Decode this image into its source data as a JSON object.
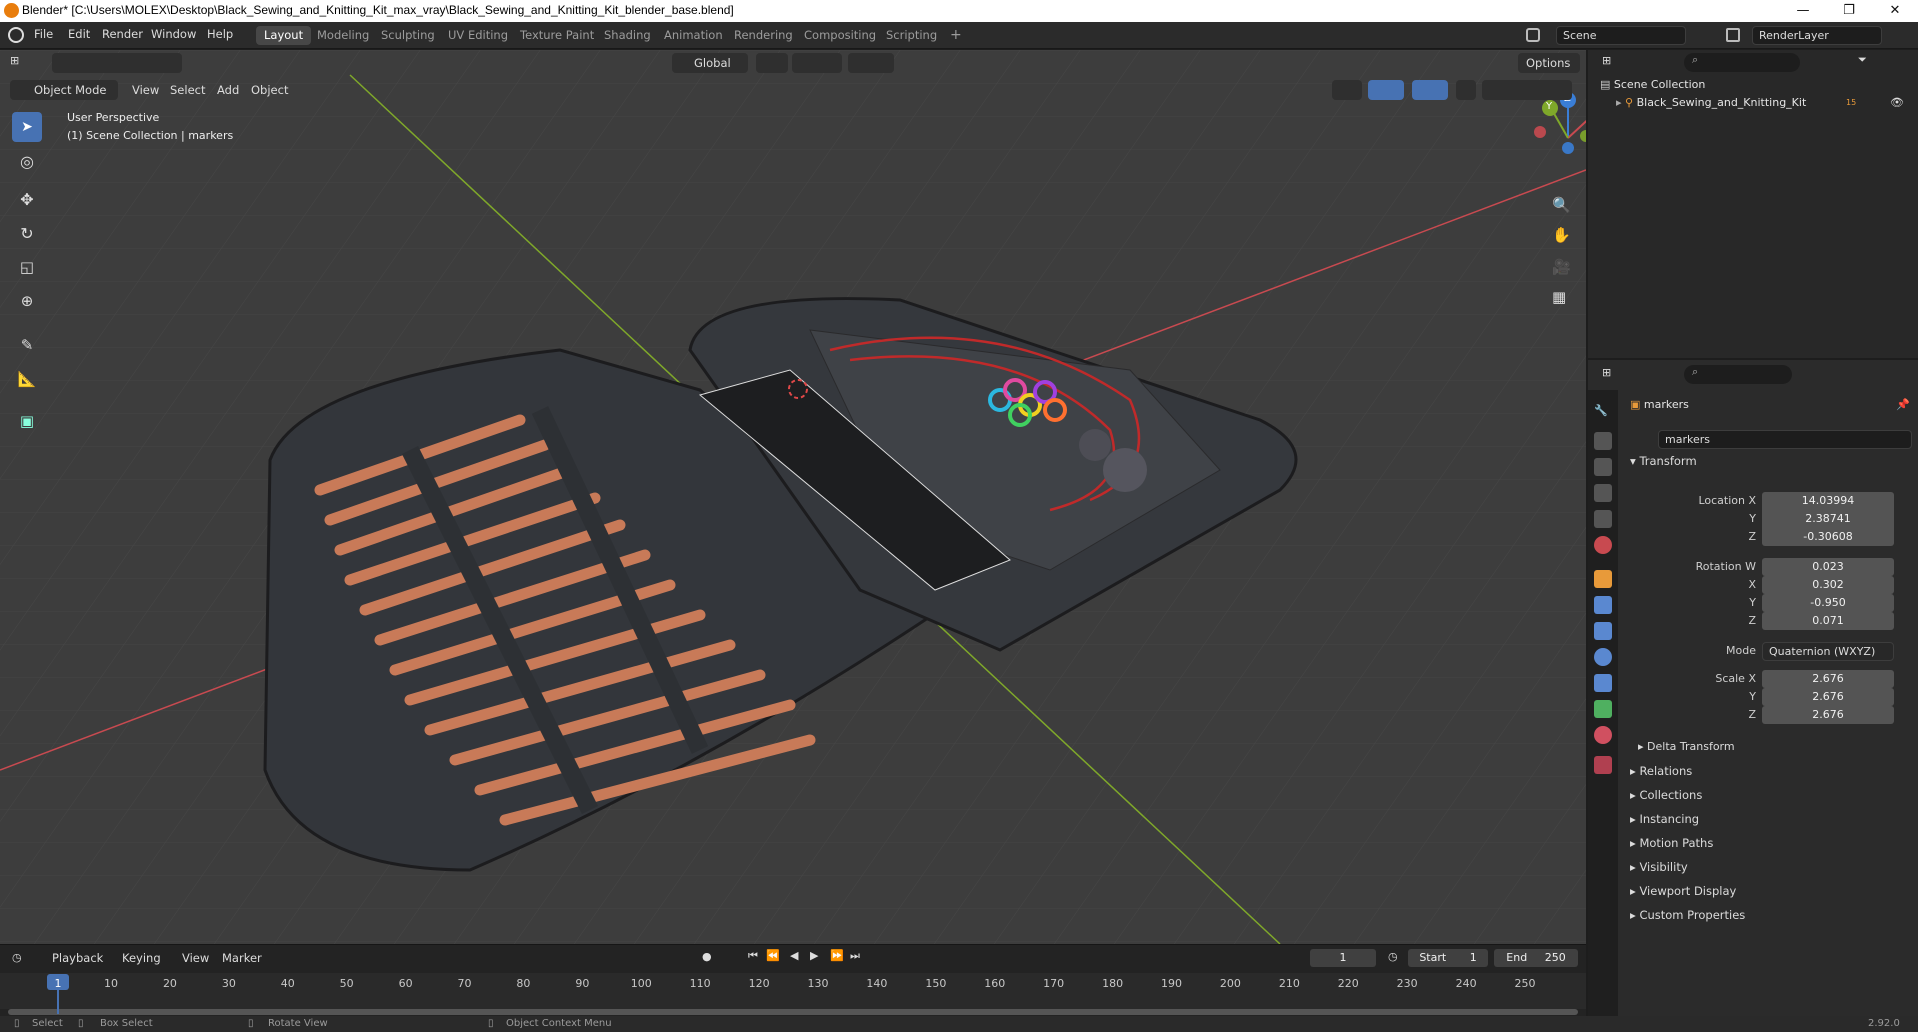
{
  "titlebar": {
    "title": "Blender* [C:\\Users\\MOLEX\\Desktop\\Black_Sewing_and_Knitting_Kit_max_vray\\Black_Sewing_and_Knitting_Kit_blender_base.blend]",
    "minimize": "—",
    "maximize": "❐",
    "close": "✕"
  },
  "menu": [
    "File",
    "Edit",
    "Render",
    "Window",
    "Help"
  ],
  "workspaces": [
    "Layout",
    "Modeling",
    "Sculpting",
    "UV Editing",
    "Texture Paint",
    "Shading",
    "Animation",
    "Rendering",
    "Compositing",
    "Scripting"
  ],
  "add_workspace": "+",
  "scene": {
    "label": "Scene",
    "renderlayer": "RenderLayer"
  },
  "viewport_header": {
    "mode": "Object Mode",
    "menus": [
      "View",
      "Select",
      "Add",
      "Object"
    ],
    "orientation": "Global",
    "options": "Options"
  },
  "viewport": {
    "overlay_line1": "User Perspective",
    "overlay_line2": "(1) Scene Collection | markers",
    "gizmo": {
      "x": "X",
      "y": "Y",
      "z": "Z"
    }
  },
  "outliner": {
    "root": "Scene Collection",
    "items": [
      {
        "name": "Black_Sewing_and_Knitting_Kit",
        "badge": "15"
      }
    ]
  },
  "properties": {
    "object_name": "markers",
    "datablock": "markers",
    "transform_label": "Transform",
    "location": {
      "label": "Location X",
      "x": "14.03994",
      "y": "2.38741",
      "z": "-0.30608"
    },
    "rotation": {
      "label": "Rotation W",
      "w": "0.023",
      "x": "0.302",
      "y": "-0.950",
      "z": "0.071"
    },
    "mode": {
      "label": "Mode",
      "value": "Quaternion (WXYZ)"
    },
    "scale": {
      "label": "Scale X",
      "x": "2.676",
      "y": "2.676",
      "z": "2.676"
    },
    "axis_labels": {
      "x": "X",
      "y": "Y",
      "z": "Z"
    },
    "delta": "Delta Transform",
    "sections": [
      "Relations",
      "Collections",
      "Instancing",
      "Motion Paths",
      "Visibility",
      "Viewport Display",
      "Custom Properties"
    ]
  },
  "timeline": {
    "menus": [
      "Playback",
      "Keying",
      "View",
      "Marker"
    ],
    "current_frame": "1",
    "start_label": "Start",
    "start": "1",
    "end_label": "End",
    "end": "250",
    "ticks": [
      "1",
      "10",
      "20",
      "30",
      "40",
      "50",
      "60",
      "70",
      "80",
      "90",
      "100",
      "110",
      "120",
      "130",
      "140",
      "150",
      "160",
      "170",
      "180",
      "190",
      "200",
      "210",
      "220",
      "230",
      "240",
      "250"
    ]
  },
  "statusbar": {
    "select": "Select",
    "box_select": "Box Select",
    "rotate_view": "Rotate View",
    "context_menu": "Object Context Menu",
    "version": "2.92.0"
  },
  "colors": {
    "accent": "#4772b3",
    "x_axis": "#c84a50",
    "y_axis": "#7fa82a",
    "z_axis": "#3a7ed6",
    "active_tab": "#474747"
  }
}
